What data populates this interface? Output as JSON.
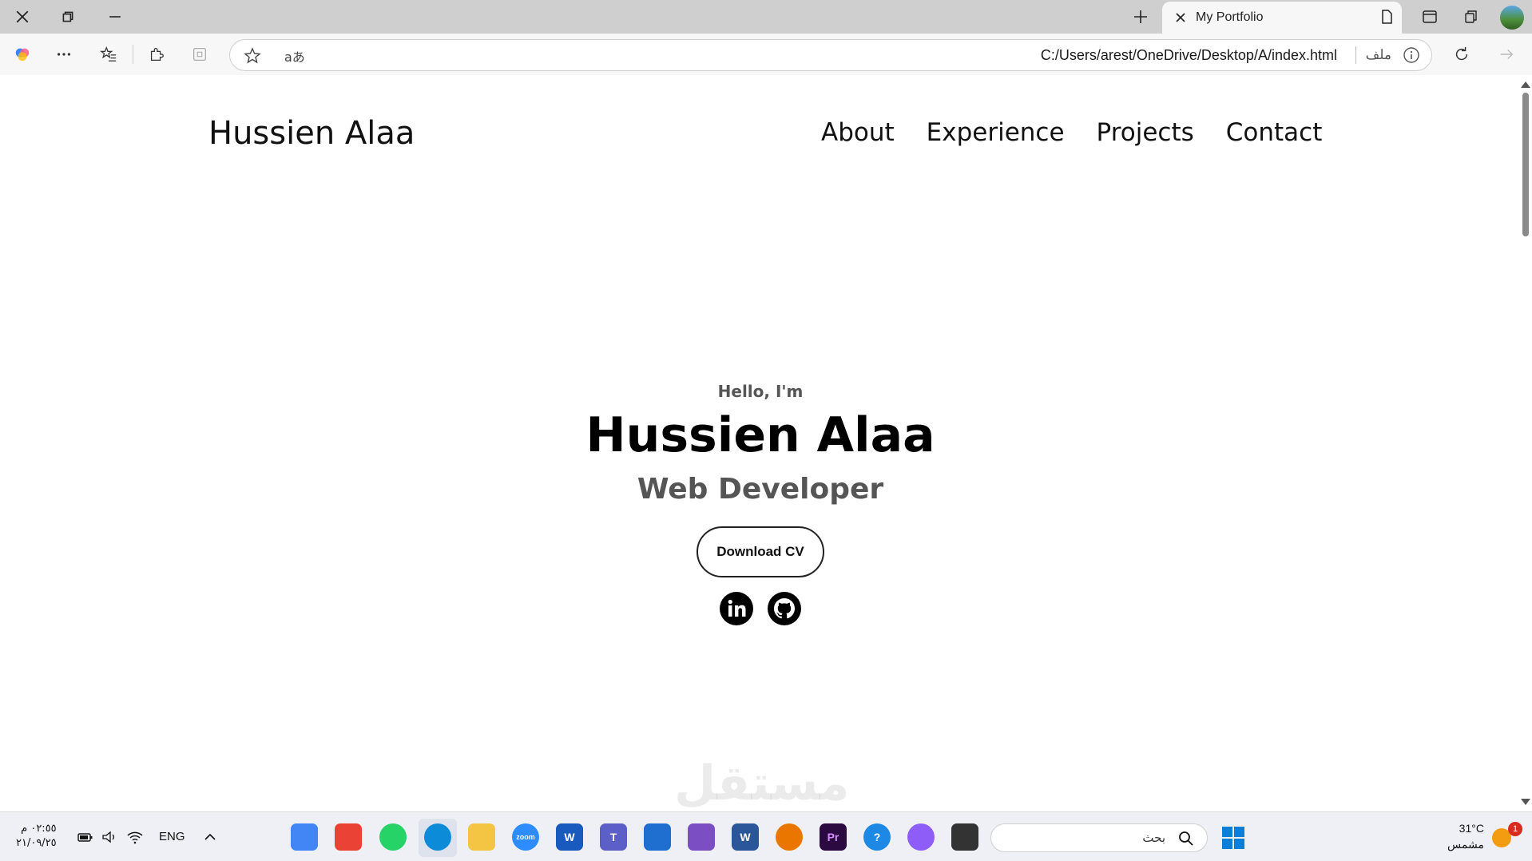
{
  "browser": {
    "tab": {
      "title": "My Portfolio"
    },
    "address": {
      "url": "C:/Users/arest/OneDrive/Desktop/A/index.html",
      "scheme_label": "ملف",
      "read_aloud": "aあ"
    }
  },
  "site": {
    "logo": "Hussien Alaa",
    "nav": [
      "About",
      "Experience",
      "Projects",
      "Contact"
    ],
    "hero": {
      "greeting": "Hello, I'm",
      "name": "Hussien Alaa",
      "role": "Web Developer",
      "cta": "Download CV"
    },
    "watermark": "مستقل"
  },
  "taskbar": {
    "time": "٠٢:٥٥ م",
    "date": "٢١/٠٩/٢٥",
    "language": "ENG",
    "search_placeholder": "بحث",
    "weather_temp": "31°C",
    "weather_desc": "مشمس",
    "notification_count": "1",
    "apps": [
      {
        "name": "chrome-h-icon",
        "label": "",
        "color": "#4285f4"
      },
      {
        "name": "chrome-h2-icon",
        "label": "",
        "color": "#ea4335"
      },
      {
        "name": "whatsapp-icon",
        "label": "",
        "color": "#25d366"
      },
      {
        "name": "edge-icon",
        "label": "",
        "color": "#0c8cd8"
      },
      {
        "name": "file-explorer-icon",
        "label": "",
        "color": "#f4c542"
      },
      {
        "name": "zoom-icon",
        "label": "zoom",
        "color": "#2d8cff"
      },
      {
        "name": "word-icon",
        "label": "W",
        "color": "#185abd"
      },
      {
        "name": "teams-icon",
        "label": "T",
        "color": "#5b5fc7"
      },
      {
        "name": "store-icon",
        "label": "",
        "color": "#1f6fd1"
      },
      {
        "name": "visual-studio-icon",
        "label": "",
        "color": "#7b4fc3"
      },
      {
        "name": "word2-icon",
        "label": "W",
        "color": "#2b579a"
      },
      {
        "name": "blender-icon",
        "label": "",
        "color": "#ea7600"
      },
      {
        "name": "premiere-icon",
        "label": "Pr",
        "color": "#2a0a40"
      },
      {
        "name": "help-icon",
        "label": "?",
        "color": "#1e88e5"
      },
      {
        "name": "copilot-icon",
        "label": "",
        "color": "#8e5cf6"
      },
      {
        "name": "terminal-icon",
        "label": "",
        "color": "#333333"
      }
    ]
  }
}
